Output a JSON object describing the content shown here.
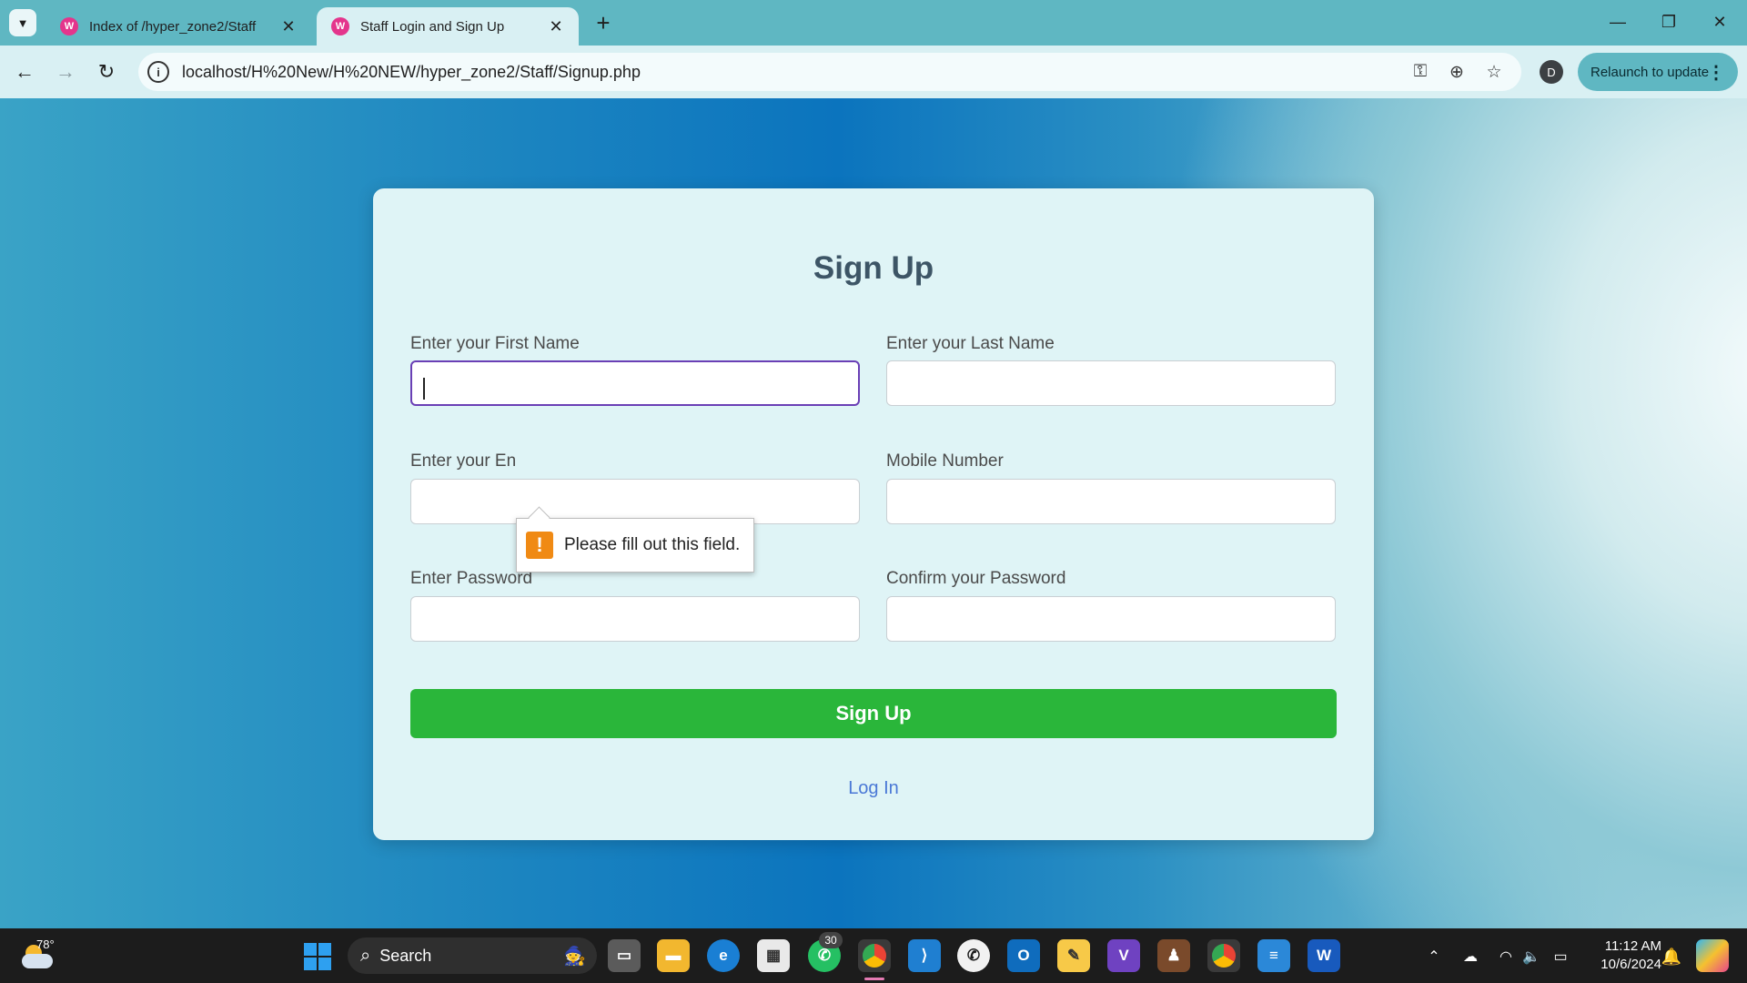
{
  "browser": {
    "tabs": [
      {
        "title": "Index of /hyper_zone2/Staff",
        "favicon": "wamp-icon",
        "active": false
      },
      {
        "title": "Staff Login and Sign Up",
        "favicon": "wamp-icon",
        "active": true
      }
    ],
    "url": "localhost/H%20New/H%20NEW/hyper_zone2/Staff/Signup.php",
    "profile_initial": "D",
    "relaunch_label": "Relaunch to update"
  },
  "form": {
    "title": "Sign Up",
    "first_name_label": "Enter your First Name",
    "last_name_label": "Enter your Last Name",
    "email_label": "Enter your En",
    "mobile_label": "Mobile Number",
    "password_label": "Enter Password",
    "confirm_password_label": "Confirm your Password",
    "first_name_value": "",
    "last_name_value": "",
    "email_value": "",
    "mobile_value": "",
    "password_value": "",
    "confirm_password_value": "",
    "submit_label": "Sign Up",
    "login_link": "Log In",
    "validation_message": "Please fill out this field."
  },
  "taskbar": {
    "weather_temp": "78°",
    "search_label": "Search",
    "whatsapp_badge": "30",
    "time": "11:12 AM",
    "date": "10/6/2024"
  },
  "colors": {
    "submit": "#2ab63a",
    "card": "#dff4f6",
    "link": "#4a78d6",
    "focus_border": "#6a3fb5"
  }
}
